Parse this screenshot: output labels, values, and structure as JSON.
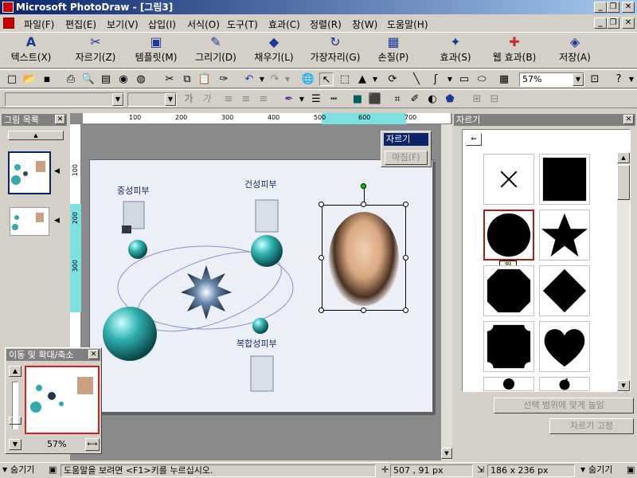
{
  "window": {
    "title": "Microsoft PhotoDraw - [그림3]"
  },
  "menu": [
    "파일(F)",
    "편집(E)",
    "보기(V)",
    "삽입(I)",
    "서식(O)",
    "도구(T)",
    "효과(C)",
    "정렬(R)",
    "창(W)",
    "도움말(H)"
  ],
  "big_toolbar": [
    {
      "label": "텍스트(X)",
      "icon": "text-icon"
    },
    {
      "label": "자르기(Z)",
      "icon": "scissors-icon"
    },
    {
      "label": "템플릿(M)",
      "icon": "template-icon"
    },
    {
      "label": "그리기(D)",
      "icon": "draw-icon"
    },
    {
      "label": "채우기(L)",
      "icon": "fill-icon"
    },
    {
      "label": "가장자리(G)",
      "icon": "edge-icon"
    },
    {
      "label": "손질(P)",
      "icon": "touchup-icon"
    },
    {
      "label": "효과(S)",
      "icon": "effects-icon"
    },
    {
      "label": "웹 효과(B)",
      "icon": "web-effects-icon"
    },
    {
      "label": "저장(A)",
      "icon": "save-icon"
    }
  ],
  "zoom": "57%",
  "font_buttons": {
    "bold": "가",
    "italic": "가"
  },
  "picture_list": {
    "title": "그림 목록"
  },
  "pan_zoom": {
    "title": "이동 및 확대/축소",
    "zoom": "57%"
  },
  "canvas": {
    "labels": {
      "jungseong": "중성피부",
      "geonseong": "건성피부",
      "bokhap": "복합성피부"
    }
  },
  "context_menu": {
    "items": [
      "자르기",
      "마침(F)"
    ]
  },
  "ruler": {
    "ticks": [
      "100",
      "200",
      "300",
      "400",
      "500",
      "600",
      "700"
    ],
    "vticks": [
      "100",
      "200",
      "300"
    ]
  },
  "crop_panel": {
    "title": "자르기",
    "tooltip": "원",
    "fit_button": "선택 범위에 맞게 늘임",
    "lock_button": "자르기 고정"
  },
  "status": {
    "hide_left": "숨기기",
    "help": "도움말을 보려면 <F1>키를 누르십시오.",
    "coords": "507 , 91  px",
    "size": "186 x 236  px",
    "hide_right": "숨기기"
  }
}
